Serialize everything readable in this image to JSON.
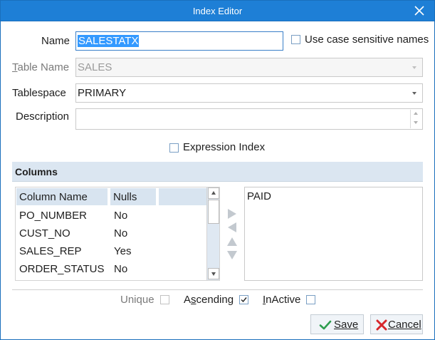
{
  "window": {
    "title": "Index Editor",
    "close_icon": "close-icon"
  },
  "form": {
    "name_label": "Name",
    "name_value": "SALESTATX",
    "case_sensitive_label": "Use case sensitive names",
    "case_sensitive_checked": false,
    "table_name_label": "Table Name",
    "table_name_value": "SALES",
    "tablespace_label": "Tablespace",
    "tablespace_value": "PRIMARY",
    "description_label": "Description",
    "description_value": "",
    "expression_index_label": "Expression Index",
    "expression_index_checked": false
  },
  "columns_section": {
    "title": "Columns",
    "headers": [
      "Column Name",
      "Nulls"
    ],
    "rows": [
      {
        "name": "PO_NUMBER",
        "nulls": "No"
      },
      {
        "name": "CUST_NO",
        "nulls": "No"
      },
      {
        "name": "SALES_REP",
        "nulls": "Yes"
      },
      {
        "name": "ORDER_STATUS",
        "nulls": "No"
      }
    ],
    "selected_columns": [
      "PAID"
    ],
    "mover_icons": [
      "move-right-icon",
      "move-left-icon",
      "move-up-icon",
      "move-down-icon"
    ]
  },
  "options": {
    "unique_label": "Unique",
    "unique_checked": false,
    "ascending_label": "Ascending",
    "ascending_checked": true,
    "inactive_label": "InActive",
    "inactive_checked": false
  },
  "buttons": {
    "save_label": "Save",
    "cancel_label": "Cancel"
  },
  "colors": {
    "title_bar": "#1e7fd6",
    "section_header": "#dbe6f1",
    "selection": "#3399ff",
    "save_icon": "#2e9e4f",
    "cancel_icon": "#d7262b"
  }
}
